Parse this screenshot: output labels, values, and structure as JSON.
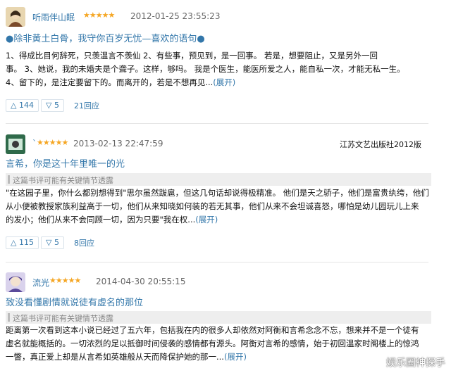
{
  "reviews": [
    {
      "author": "听雨伴山眠",
      "stars": "★★★★★",
      "time": "2012-01-25 23:55:23",
      "source": "",
      "title": "●除非黄土白骨，我守你百岁无忧—喜欢的语句●",
      "spoiler": "",
      "lines": [
        "1、得成比目何辞死，只羡温言不羡仙        2、有些事，预见到，是一回事。         若是，想要阻止，又是另外一回",
        "事。 3、她说，我的未婚夫是个聋子。这样，够吗。        我是个医生，能医所爱之人，能自私一次，才能无私一生。",
        "4、留下的，是注定要留下的。而离开的，若是不想再见..."
      ],
      "expand": "(展开)",
      "up": "144",
      "down": "5",
      "reply": "21回应"
    },
    {
      "author": "`",
      "stars": "★★★★★",
      "time": "2013-02-13 22:47:59",
      "source": "江苏文艺出版社2012版",
      "title": "言希，你是这十年里唯一的光",
      "spoiler": "这篇书评可能有关键情节透露",
      "lines": [
        "\"在这园子里，你什么都别想得到\"思尔虽然跋扈，但这几句话却说得极精准。  他们是天之骄子，他们是富贵纨绔，他们",
        "从小便被教授家族利益高于一切，他们从来知晓如何装的若无其事，他们从来不会坦诚喜怒，哪怕是幼儿园玩儿上来",
        "的发小；他们从来不会同顾一切，因为只要\"我在权..."
      ],
      "expand": "(展开)",
      "up": "115",
      "down": "5",
      "reply": "8回应"
    },
    {
      "author": "流光",
      "stars": "★★★★★",
      "time": "2014-04-30 20:55:15",
      "source": "",
      "title": "致没看懂剧情就说徒有虚名的那位",
      "spoiler": "这篇书评可能有关键情节透露",
      "lines": [
        "距离第一次看到这本小说已经过了五六年，包括我在内的很多人却依然对阿衡和言希念念不忘，想来并不是一个徒有",
        "虚名就能概括的。一切浓烈的足以抵御时间侵袭的感情都有源头。阿衡对言希的感情，始于初回温家时阁楼上的惊鸿",
        "一瞥，真正爱上却是从言希如英雄般从天而降保护她的那一..."
      ],
      "expand": "(展开)"
    }
  ],
  "watermark": "娱乐圈神探手"
}
